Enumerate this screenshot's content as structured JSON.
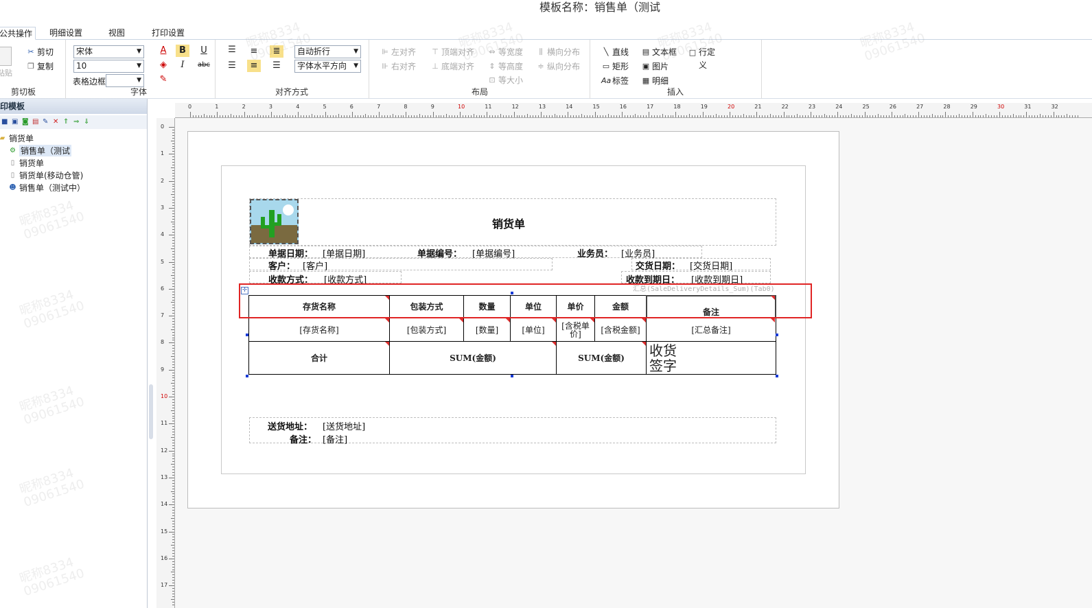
{
  "window": {
    "title": "模板名称：销售单（测试"
  },
  "tabs": [
    {
      "label": "公共操作",
      "active": true
    },
    {
      "label": "明细设置",
      "active": false
    },
    {
      "label": "视图",
      "active": false
    },
    {
      "label": "打印设置",
      "active": false
    }
  ],
  "ribbon": {
    "clipboard": {
      "label": "剪切板",
      "paste": "粘贴",
      "cut": "剪切",
      "copy": "复制"
    },
    "font": {
      "label": "字体",
      "name": "宋体",
      "size": "10",
      "border_label": "表格边框",
      "bold": "B",
      "italic": "I",
      "underline": "U",
      "strike": "abc",
      "color": "A"
    },
    "align": {
      "label": "对齐方式",
      "wrap": "自动折行",
      "hdir": "字体水平方向"
    },
    "layout": {
      "label": "布局",
      "left": "左对齐",
      "right": "右对齐",
      "top": "顶端对齐",
      "bottom": "底端对齐",
      "same_width": "等宽度",
      "same_height": "等高度",
      "same_size": "等大小",
      "hdist": "横向分布",
      "vdist": "纵向分布"
    },
    "insert": {
      "label": "插入",
      "line": "直线",
      "rect": "矩形",
      "tag": "标签",
      "textbox": "文本框",
      "image": "图片",
      "detail": "明细",
      "rowdef": "行定义"
    }
  },
  "left_panel": {
    "title": "打印模板",
    "tree": {
      "root": "销货单",
      "items": [
        "销售单（测试",
        "销货单",
        "销货单(移动仓管)",
        "销售单（测试中）"
      ]
    }
  },
  "rulers": {
    "h": [
      "0",
      "1",
      "2",
      "3",
      "4",
      "5",
      "6",
      "7",
      "8",
      "9",
      "10",
      "11",
      "12",
      "13",
      "14",
      "15",
      "16",
      "17",
      "18",
      "19",
      "20",
      "21",
      "22",
      "23",
      "24",
      "25",
      "26",
      "27",
      "28",
      "29",
      "30",
      "31",
      "32"
    ],
    "v": [
      "0",
      "1",
      "2",
      "3",
      "4",
      "5",
      "6",
      "7",
      "8",
      "9",
      "10",
      "11",
      "12",
      "13",
      "14",
      "15",
      "16",
      "17"
    ]
  },
  "report": {
    "title": "销货单",
    "header": {
      "date_label": "单据日期：",
      "date_val": "[单据日期]",
      "no_label": "单据编号：",
      "no_val": "[单据编号]",
      "staff_label": "业务员：",
      "staff_val": "[业务员]",
      "cust_label": "客户：",
      "cust_val": "[客户]",
      "deliv_label": "交货日期：",
      "deliv_val": "[交货日期]",
      "pay_label": "收款方式：",
      "pay_val": "[收款方式]",
      "due_label": "收款到期日：",
      "due_val": "[收款到期日]"
    },
    "table_source": "汇总(SaleDeliveryDetails_Sum)(Tab0)",
    "columns": [
      "存货名称",
      "包装方式",
      "数量",
      "单位",
      "单价",
      "金额",
      "备注"
    ],
    "row": [
      "[存货名称]",
      "[包装方式]",
      "[数量]",
      "[单位]",
      "[含税单价]",
      "[含税金额]",
      "[汇总备注]"
    ],
    "total": {
      "label": "合计",
      "sum1": "SUM(金额)",
      "sum2": "SUM(金额)",
      "sign": "收货签字"
    },
    "footer": {
      "addr_label": "送货地址：",
      "addr_val": "[送货地址]",
      "memo_label": "备注：",
      "memo_val": "[备注]"
    }
  },
  "watermark": {
    "line1": "昵称8334",
    "line2": "09061540"
  },
  "colors": {
    "highlight": "#e02424",
    "handle": "#1a3cd6",
    "corner_mark": "#e03030",
    "ruler_red": "#d00000"
  }
}
